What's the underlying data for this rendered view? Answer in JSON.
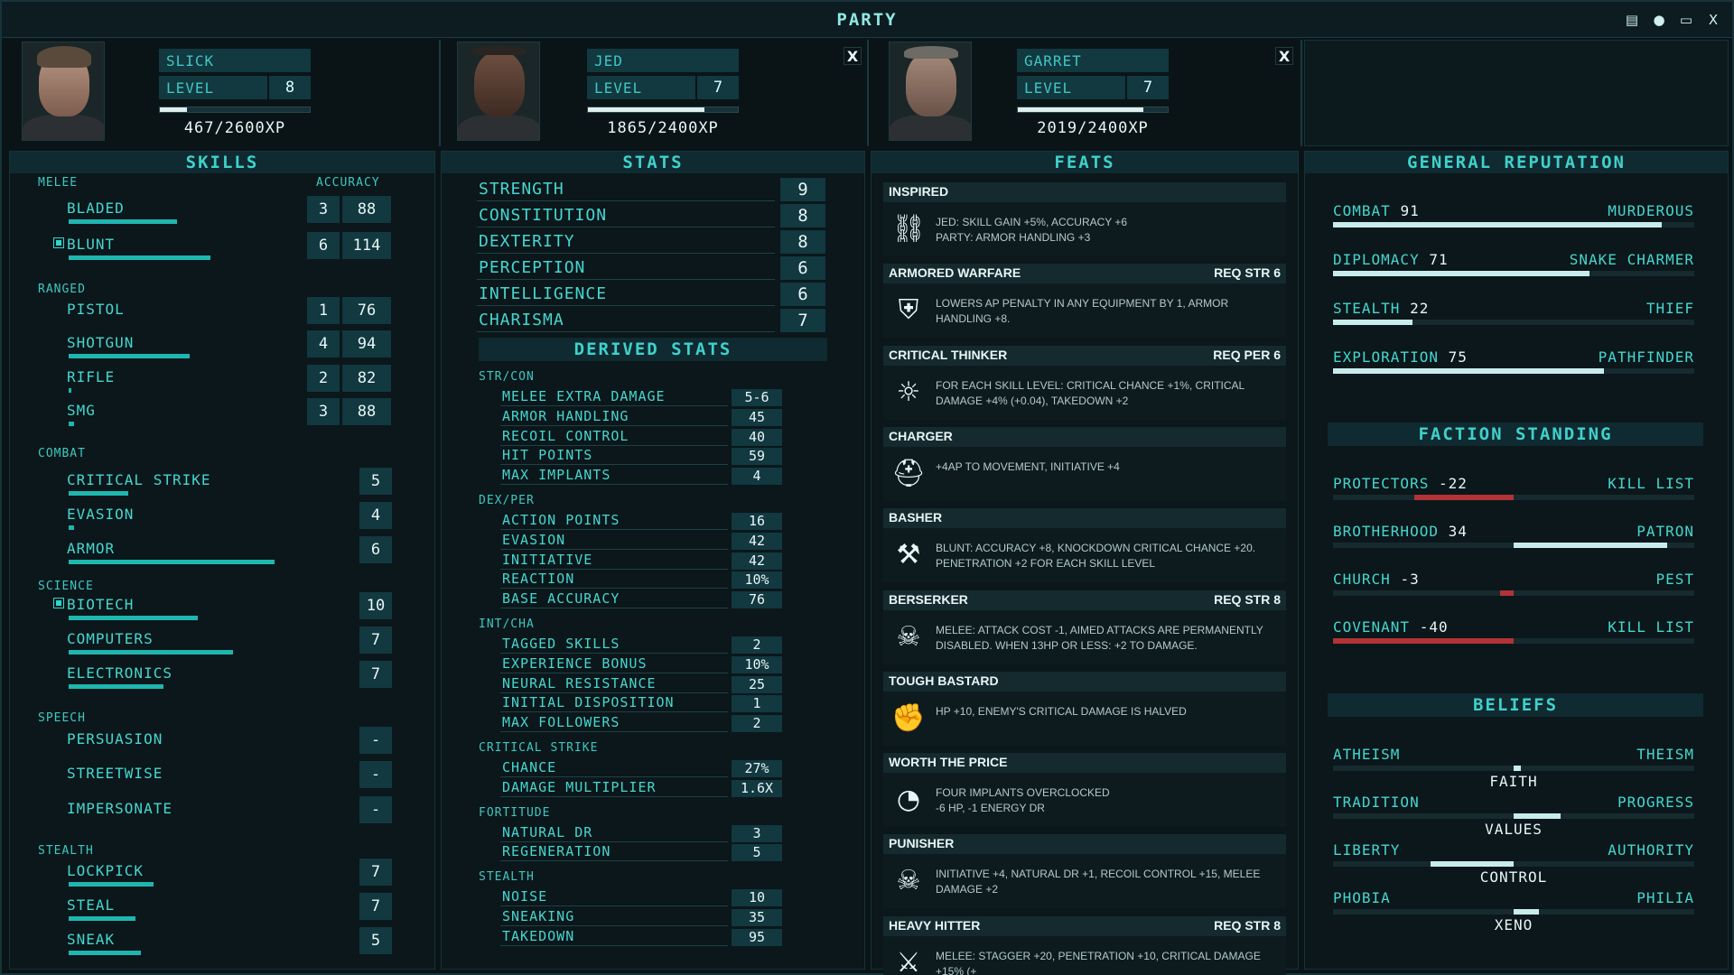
{
  "window": {
    "title": "PARTY"
  },
  "members": [
    {
      "name": "SLICK",
      "level_label": "LEVEL",
      "level": "8",
      "xp_text": "467/2600XP",
      "xp_fraction": 0.18
    },
    {
      "name": "JED",
      "level_label": "LEVEL",
      "level": "7",
      "xp_text": "1865/2400XP",
      "xp_fraction": 0.78
    },
    {
      "name": "GARRET",
      "level_label": "LEVEL",
      "level": "7",
      "xp_text": "2019/2400XP",
      "xp_fraction": 0.84
    }
  ],
  "close_label": "X",
  "skills": {
    "title": "SKILLS",
    "accuracy_header": "ACCURACY",
    "categories": [
      "MELEE",
      "RANGED",
      "COMBAT",
      "SCIENCE",
      "SPEECH",
      "STEALTH"
    ],
    "items": [
      {
        "label": "BLADED",
        "value": "3",
        "accuracy": "88",
        "fill": 0.42,
        "tagged": false
      },
      {
        "label": "BLUNT",
        "value": "6",
        "accuracy": "114",
        "fill": 0.55,
        "tagged": true
      },
      {
        "label": "PISTOL",
        "value": "1",
        "accuracy": "76",
        "fill": 0.0,
        "tagged": false
      },
      {
        "label": "SHOTGUN",
        "value": "4",
        "accuracy": "94",
        "fill": 0.47,
        "tagged": false
      },
      {
        "label": "RIFLE",
        "value": "2",
        "accuracy": "82",
        "fill": 0.01,
        "tagged": false
      },
      {
        "label": "SMG",
        "value": "3",
        "accuracy": "88",
        "fill": 0.02,
        "tagged": false
      },
      {
        "label": "CRITICAL STRIKE",
        "value": "5",
        "fill": 0.23,
        "tagged": false
      },
      {
        "label": "EVASION",
        "value": "4",
        "fill": 0.02,
        "tagged": false
      },
      {
        "label": "ARMOR",
        "value": "6",
        "fill": 0.8,
        "tagged": false
      },
      {
        "label": "BIOTECH",
        "value": "10",
        "fill": 0.5,
        "tagged": true
      },
      {
        "label": "COMPUTERS",
        "value": "7",
        "fill": 0.64,
        "tagged": false
      },
      {
        "label": "ELECTRONICS",
        "value": "7",
        "fill": 0.37,
        "tagged": false
      },
      {
        "label": "PERSUASION",
        "value": "-",
        "fill": 0.0,
        "tagged": false
      },
      {
        "label": "STREETWISE",
        "value": "-",
        "fill": 0.0,
        "tagged": false
      },
      {
        "label": "IMPERSONATE",
        "value": "-",
        "fill": 0.0,
        "tagged": false
      },
      {
        "label": "LOCKPICK",
        "value": "7",
        "fill": 0.33,
        "tagged": false
      },
      {
        "label": "STEAL",
        "value": "7",
        "fill": 0.26,
        "tagged": false
      },
      {
        "label": "SNEAK",
        "value": "5",
        "fill": 0.28,
        "tagged": false
      }
    ]
  },
  "stats": {
    "title": "STATS",
    "items": [
      {
        "label": "STRENGTH",
        "value": "9"
      },
      {
        "label": "CONSTITUTION",
        "value": "8"
      },
      {
        "label": "DEXTERITY",
        "value": "8"
      },
      {
        "label": "PERCEPTION",
        "value": "6"
      },
      {
        "label": "INTELLIGENCE",
        "value": "6"
      },
      {
        "label": "CHARISMA",
        "value": "7"
      }
    ]
  },
  "derived": {
    "title": "DERIVED STATS",
    "groups": [
      {
        "name": "STR/CON",
        "items": [
          {
            "label": "MELEE EXTRA DAMAGE",
            "value": "5-6"
          },
          {
            "label": "ARMOR HANDLING",
            "value": "45"
          },
          {
            "label": "RECOIL CONTROL",
            "value": "40"
          },
          {
            "label": "HIT POINTS",
            "value": "59"
          },
          {
            "label": "MAX IMPLANTS",
            "value": "4"
          }
        ]
      },
      {
        "name": "DEX/PER",
        "items": [
          {
            "label": "ACTION POINTS",
            "value": "16"
          },
          {
            "label": "EVASION",
            "value": "42"
          },
          {
            "label": "INITIATIVE",
            "value": "42"
          },
          {
            "label": "REACTION",
            "value": "10%"
          },
          {
            "label": "BASE ACCURACY",
            "value": "76"
          }
        ]
      },
      {
        "name": "INT/CHA",
        "items": [
          {
            "label": "TAGGED SKILLS",
            "value": "2"
          },
          {
            "label": "EXPERIENCE BONUS",
            "value": "10%"
          },
          {
            "label": "NEURAL RESISTANCE",
            "value": "25"
          },
          {
            "label": "INITIAL DISPOSITION",
            "value": "1"
          },
          {
            "label": "MAX FOLLOWERS",
            "value": "2"
          }
        ]
      },
      {
        "name": "CRITICAL STRIKE",
        "items": [
          {
            "label": "CHANCE",
            "value": "27%"
          },
          {
            "label": "DAMAGE MULTIPLIER",
            "value": "1.6x"
          }
        ]
      },
      {
        "name": "FORTITUDE",
        "items": [
          {
            "label": "NATURAL DR",
            "value": "3"
          },
          {
            "label": "REGENERATION",
            "value": "5"
          }
        ]
      },
      {
        "name": "STEALTH",
        "items": [
          {
            "label": "NOISE",
            "value": "10"
          },
          {
            "label": "SNEAKING",
            "value": "35"
          },
          {
            "label": "TAKEDOWN",
            "value": "95"
          }
        ]
      }
    ]
  },
  "feats": {
    "title": "FEATS",
    "items": [
      {
        "name": "INSPIRED",
        "req": "",
        "icon": "chain-icon",
        "desc": "JED: SKILL GAIN +5%, ACCURACY +6\nPARTY: ARMOR HANDLING +3"
      },
      {
        "name": "ARMORED WARFARE",
        "req": "REQ STR 6",
        "icon": "armor-icon",
        "desc": "LOWERS AP PENALTY IN ANY EQUIPMENT BY 1, ARMOR HANDLING +8."
      },
      {
        "name": "CRITICAL THINKER",
        "req": "REQ PER 6",
        "icon": "lightbulb-icon",
        "desc": "FOR EACH SKILL LEVEL: CRITICAL CHANCE +1%, CRITICAL DAMAGE +4% (+0.04), TAKEDOWN +2"
      },
      {
        "name": "CHARGER",
        "req": "",
        "icon": "helmet-icon",
        "desc": "+4AP TO MOVEMENT, INITIATIVE +4"
      },
      {
        "name": "BASHER",
        "req": "",
        "icon": "hammer-icon",
        "desc": "BLUNT: ACCURACY +8, KNOCKDOWN CRITICAL CHANCE +20. PENETRATION +2 FOR EACH SKILL LEVEL"
      },
      {
        "name": "BERSERKER",
        "req": "REQ STR 8",
        "icon": "skull-icon",
        "desc": "MELEE: ATTACK COST -1, AIMED ATTACKS ARE PERMANENTLY DISABLED. WHEN 13HP OR LESS: +2 TO DAMAGE."
      },
      {
        "name": "TOUGH BASTARD",
        "req": "",
        "icon": "fist-icon",
        "desc": "HP +10, ENEMY'S CRITICAL DAMAGE IS HALVED"
      },
      {
        "name": "WORTH THE PRICE",
        "req": "",
        "icon": "gauge-icon",
        "desc": "FOUR IMPLANTS OVERCLOCKED\n-6 HP, -1 ENERGY DR"
      },
      {
        "name": "PUNISHER",
        "req": "",
        "icon": "punisher-skull-icon",
        "desc": "INITIATIVE +4, NATURAL DR +1, RECOIL CONTROL +15, MELEE DAMAGE +2"
      },
      {
        "name": "HEAVY HITTER",
        "req": "REQ STR 8",
        "icon": "bat-icon",
        "desc": "MELEE: STAGGER +20, PENETRATION +10, CRITICAL DAMAGE +15% (+"
      }
    ]
  },
  "reputation": {
    "title": "GENERAL REPUTATION",
    "items": [
      {
        "label": "COMBAT",
        "value": "91",
        "rank": "MURDEROUS",
        "fill": 0.91
      },
      {
        "label": "DIPLOMACY",
        "value": "71",
        "rank": "SNAKE CHARMER",
        "fill": 0.71
      },
      {
        "label": "STEALTH",
        "value": "22",
        "rank": "THIEF",
        "fill": 0.22
      },
      {
        "label": "EXPLORATION",
        "value": "75",
        "rank": "PATHFINDER",
        "fill": 0.75
      }
    ]
  },
  "factions": {
    "title": "FACTION STANDING",
    "items": [
      {
        "label": "PROTECTORS",
        "value": "-22",
        "rank": "KILL LIST",
        "level": -22
      },
      {
        "label": "BROTHERHOOD",
        "value": "34",
        "rank": "PATRON",
        "level": 34
      },
      {
        "label": "CHURCH",
        "value": "-3",
        "rank": "PEST",
        "level": -3
      },
      {
        "label": "COVENANT",
        "value": "-40",
        "rank": "KILL LIST",
        "level": -40
      }
    ]
  },
  "beliefs": {
    "title": "BELIEFS",
    "items": [
      {
        "left": "ATHEISM",
        "right": "THEISM",
        "center": "FAITH",
        "from": 0.5,
        "to": 0.52
      },
      {
        "left": "TRADITION",
        "right": "PROGRESS",
        "center": "VALUES",
        "from": 0.5,
        "to": 0.63
      },
      {
        "left": "LIBERTY",
        "right": "AUTHORITY",
        "center": "CONTROL",
        "from": 0.27,
        "to": 0.5
      },
      {
        "left": "PHOBIA",
        "right": "PHILIA",
        "center": "XENO",
        "from": 0.5,
        "to": 0.57
      }
    ]
  },
  "colors": {
    "accent": "#3fc7c2",
    "bar": "#1fb6b0",
    "negative": "#b23336",
    "panel": "#0b171a"
  }
}
